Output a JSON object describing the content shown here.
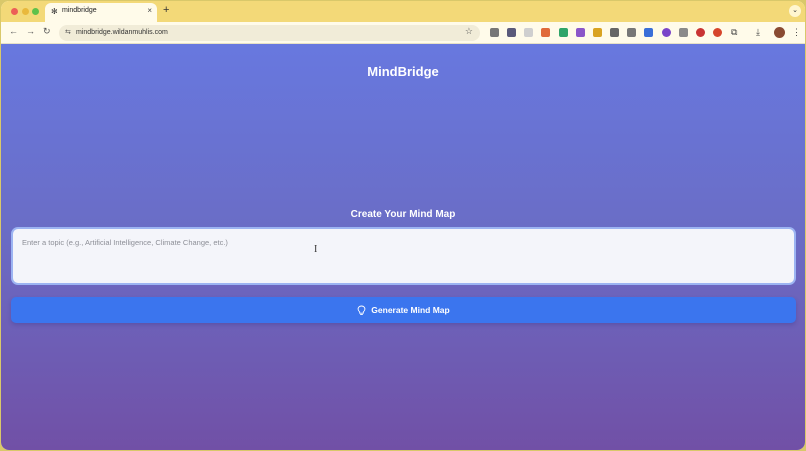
{
  "browser": {
    "tab_title": "mindbridge",
    "tab_close": "×",
    "new_tab": "+",
    "tab_menu": "⌄",
    "url": "mindbridge.wildanmuhlis.com",
    "back": "←",
    "forward": "→",
    "reload": "↻",
    "site_info": "⇆",
    "bookmark": "☆",
    "menu": "⋮",
    "download": "⤓",
    "extensions": [
      {
        "name": "ext-1",
        "color": "#777777"
      },
      {
        "name": "ext-2",
        "color": "#5a5a7a"
      },
      {
        "name": "ext-3",
        "color": "#cfcfcf"
      },
      {
        "name": "ext-4",
        "color": "#e06a3a"
      },
      {
        "name": "ext-5",
        "color": "#2fa56a"
      },
      {
        "name": "ext-6",
        "color": "#8b56c9"
      },
      {
        "name": "ext-7",
        "color": "#d9a321"
      },
      {
        "name": "ext-8",
        "color": "#666666"
      },
      {
        "name": "ext-9",
        "color": "#777777"
      },
      {
        "name": "ext-10",
        "color": "#3a6fd8"
      },
      {
        "name": "ext-11",
        "color": "#7a45c9"
      },
      {
        "name": "ext-12",
        "color": "#8a8a8a"
      },
      {
        "name": "ext-13",
        "color": "#c93434"
      },
      {
        "name": "ext-14",
        "color": "#d6452c"
      }
    ]
  },
  "app": {
    "title": "MindBridge",
    "section_heading": "Create Your Mind Map",
    "topic_input": {
      "placeholder": "Enter a topic (e.g., Artificial Intelligence, Climate Change, etc.)",
      "value": ""
    },
    "generate_button": "Generate Mind Map",
    "cursor": "I"
  },
  "colors": {
    "accent": "#3b75ee",
    "gradient_top": "#6878df",
    "gradient_bottom": "#7150a6"
  }
}
